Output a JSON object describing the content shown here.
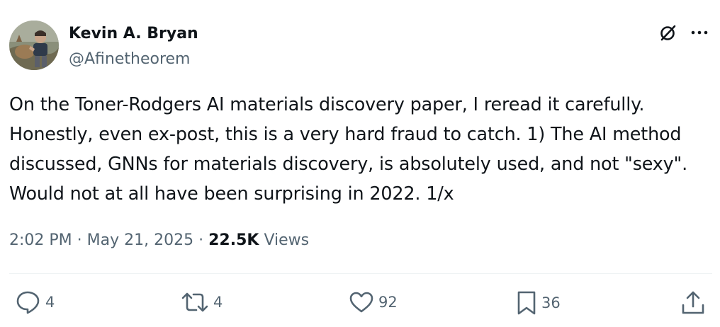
{
  "author": {
    "display_name": "Kevin A. Bryan",
    "handle": "@Afinetheorem"
  },
  "tweet": {
    "text": "On the Toner-Rodgers AI materials discovery paper, I reread it carefully.\nHonestly, even ex-post, this is a very hard fraud to catch. 1) The AI method\ndiscussed, GNNs for materials discovery, is absolutely used, and not \"sexy\".\nWould not at all have been surprising in 2022. 1/x",
    "time": "2:02 PM",
    "date": "May 21, 2025",
    "views_count": "22.5K",
    "views_label": "Views",
    "separator": "·"
  },
  "actions": {
    "replies": "4",
    "reposts": "4",
    "likes": "92",
    "bookmarks": "36"
  },
  "icons": {
    "grok": "grok-icon",
    "more": "more-icon",
    "reply": "reply-icon",
    "repost": "repost-icon",
    "like": "heart-icon",
    "bookmark": "bookmark-icon",
    "share": "share-icon"
  },
  "colors": {
    "text": "#0f1419",
    "secondary": "#536471",
    "divider": "#eff3f4"
  }
}
